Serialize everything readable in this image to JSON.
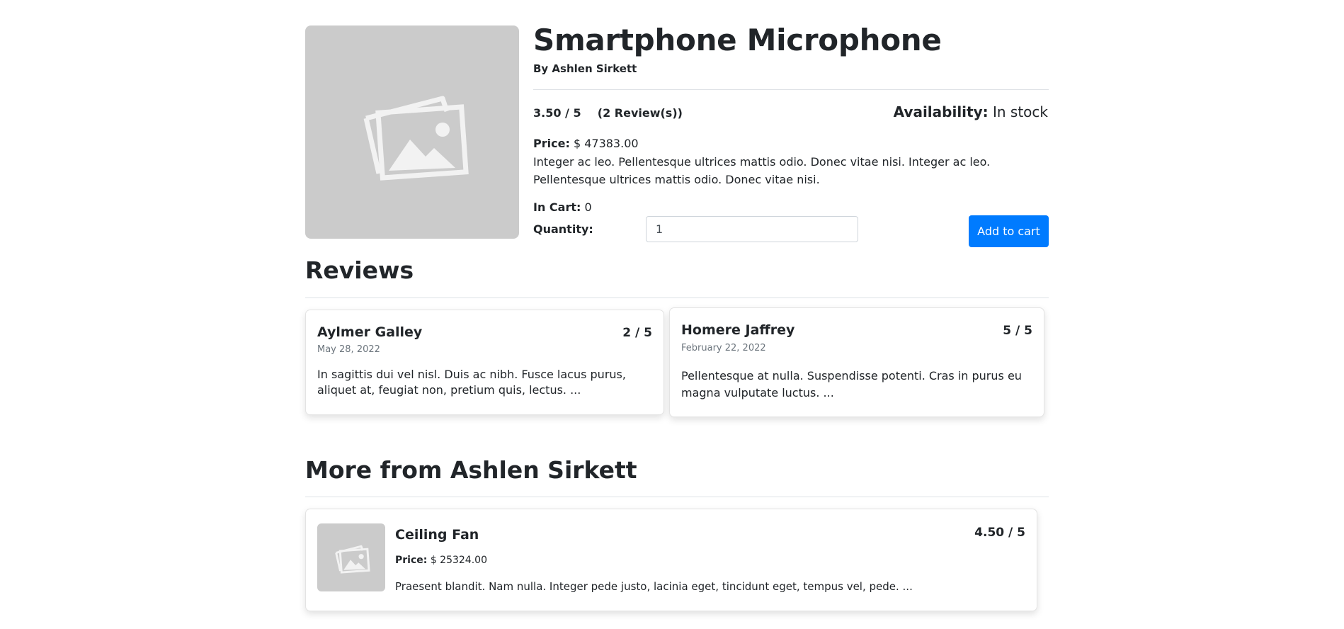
{
  "product": {
    "title": "Smartphone Microphone",
    "byline": "By Ashlen Sirkett",
    "rating": "3.50 / 5",
    "review_count": "(2 Review(s))",
    "availability_label": "Availability:",
    "availability_value": "In stock",
    "price_label": "Price:",
    "price_value": "$ 47383.00",
    "description": "Integer ac leo. Pellentesque ultrices mattis odio. Donec vitae nisi. Integer ac leo. Pellentesque ultrices mattis odio. Donec vitae nisi.",
    "in_cart_label": "In Cart:",
    "in_cart_value": "0",
    "quantity_label": "Quantity:",
    "quantity_value": "1",
    "add_to_cart_label": "Add to cart",
    "image_icon": "image-placeholder-icon"
  },
  "reviews": {
    "heading": "Reviews",
    "items": [
      {
        "name": "Aylmer Galley",
        "score": "2 / 5",
        "date": "May 28, 2022",
        "text": "In sagittis dui vel nisl. Duis ac nibh. Fusce lacus purus, aliquet at, feugiat non, pretium quis, lectus. ..."
      },
      {
        "name": "Homere Jaffrey",
        "score": "5 / 5",
        "date": "February 22, 2022",
        "text": "Pellentesque at nulla. Suspendisse potenti. Cras in purus eu magna vulputate luctus. ..."
      }
    ]
  },
  "more_from": {
    "heading": "More from Ashlen Sirkett",
    "items": [
      {
        "name": "Ceiling Fan",
        "score": "4.50 / 5",
        "price_label": "Price:",
        "price_value": "$ 25324.00",
        "text": "Praesent blandit. Nam nulla. Integer pede justo, lacinia eget, tincidunt eget, tempus vel, pede. ..."
      }
    ]
  },
  "colors": {
    "accent": "#007bff",
    "placeholder": "#cbcbcb",
    "text": "#212529",
    "muted": "#6c757d"
  }
}
